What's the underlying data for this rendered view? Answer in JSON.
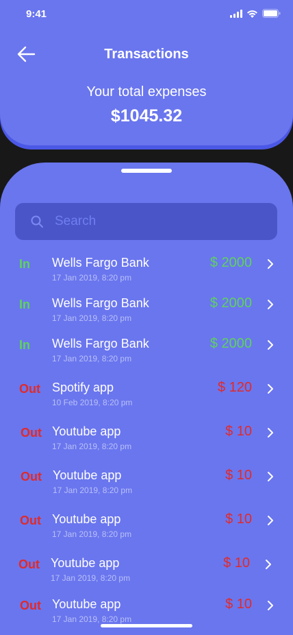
{
  "status_bar": {
    "time": "9:41"
  },
  "header": {
    "title": "Transactions",
    "total_label": "Your total expenses",
    "total_amount": "$1045.32"
  },
  "search": {
    "placeholder": "Search",
    "value": ""
  },
  "transactions": [
    {
      "type": "In",
      "kind": "in",
      "name": "Wells Fargo Bank",
      "date": "17 Jan 2019, 8:20 pm",
      "amount": "$ 2000"
    },
    {
      "type": "In",
      "kind": "in",
      "name": "Wells Fargo Bank",
      "date": "17 Jan 2019, 8:20 pm",
      "amount": "$ 2000"
    },
    {
      "type": "In",
      "kind": "in",
      "name": "Wells Fargo Bank",
      "date": "17 Jan 2019, 8:20 pm",
      "amount": "$ 2000"
    },
    {
      "type": "Out",
      "kind": "out",
      "name": "Spotify app",
      "date": "10 Feb 2019, 8:20 pm",
      "amount": "$ 120"
    },
    {
      "type": "Out",
      "kind": "out",
      "name": "Youtube app",
      "date": "17 Jan 2019, 8:20 pm",
      "amount": "$ 10"
    },
    {
      "type": "Out",
      "kind": "out",
      "name": "Youtube app",
      "date": "17 Jan 2019, 8:20 pm",
      "amount": "$ 10"
    },
    {
      "type": "Out",
      "kind": "out",
      "name": "Youtube app",
      "date": "17 Jan 2019, 8:20 pm",
      "amount": "$ 10"
    },
    {
      "type": "Out",
      "kind": "out",
      "name": "Youtube app",
      "date": "17 Jan 2019, 8:20 pm",
      "amount": "$ 10"
    },
    {
      "type": "Out",
      "kind": "out",
      "name": "Youtube app",
      "date": "17 Jan 2019, 8:20 pm",
      "amount": "$ 10"
    }
  ],
  "colors": {
    "background": "#181818",
    "card": "#6a76ee",
    "search_bg": "#4a55c8",
    "income": "#5ed25e",
    "expense": "#e02a2a"
  },
  "icons": [
    "back-arrow-icon",
    "search-icon",
    "chevron-right-icon",
    "signal-icon",
    "wifi-icon",
    "battery-icon"
  ]
}
